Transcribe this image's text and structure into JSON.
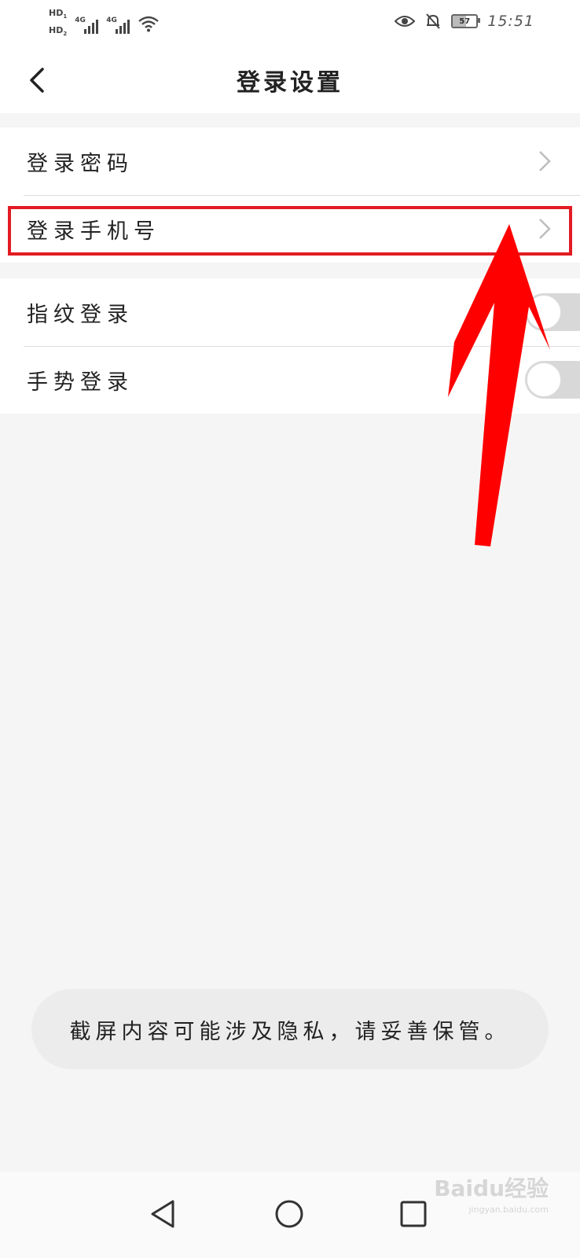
{
  "status_bar": {
    "hd1": "HD",
    "hd1_sub": "1",
    "hd2": "HD",
    "hd2_sub": "2",
    "network1": "4G",
    "network2": "4G",
    "battery_level": "57",
    "time": "15:51",
    "icons": [
      "wifi-icon",
      "eye-icon",
      "bell-off-icon",
      "battery-icon"
    ]
  },
  "header": {
    "back_icon": "chevron-left-icon",
    "title": "登录设置"
  },
  "settings": {
    "group1": [
      {
        "label": "登录密码",
        "control": "chevron-right-icon"
      },
      {
        "label": "登录手机号",
        "control": "chevron-right-icon"
      }
    ],
    "group2": [
      {
        "label": "指纹登录",
        "control": "toggle",
        "enabled": false
      },
      {
        "label": "手势登录",
        "control": "toggle",
        "enabled": false
      }
    ]
  },
  "annotation": {
    "highlight_color": "#e31b23",
    "arrow_color": "#ff0000"
  },
  "toast": {
    "message": "截屏内容可能涉及隐私，请妥善保管。"
  },
  "nav_bar": {
    "icons": [
      "back-triangle-icon",
      "home-circle-icon",
      "recents-square-icon"
    ]
  },
  "watermark": {
    "brand": "Baidu经验",
    "url": "jingyan.baidu.com"
  }
}
